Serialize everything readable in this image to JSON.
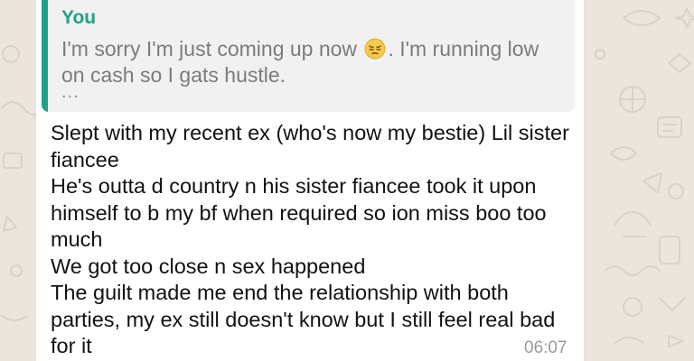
{
  "chat": {
    "quoted": {
      "author": "You",
      "text_before_emoji": "I'm sorry I'm just coming up now",
      "emoji": "pensive-face-emoji",
      "text_after_emoji": ". I'm running low on cash so I gats hustle.",
      "ellipsis": "..."
    },
    "message": {
      "lines": [
        "Slept with my recent ex (who's now my bestie) Lil sister fiancee",
        "He's outta d country n his sister fiancee took it upon himself to b my bf when required so ion miss boo too much",
        "We got too close n sex happened",
        "The guilt made me end the relationship with both parties, my ex still doesn't know but I still feel real bad for it"
      ],
      "time": "06:07"
    }
  },
  "colors": {
    "wallpaper": "#ece5dd",
    "bubble": "#ffffff",
    "quote_background": "#f1f1f1",
    "quote_accent": "#1fa187",
    "message_text": "#111111",
    "meta_text": "#9a9a9a"
  }
}
